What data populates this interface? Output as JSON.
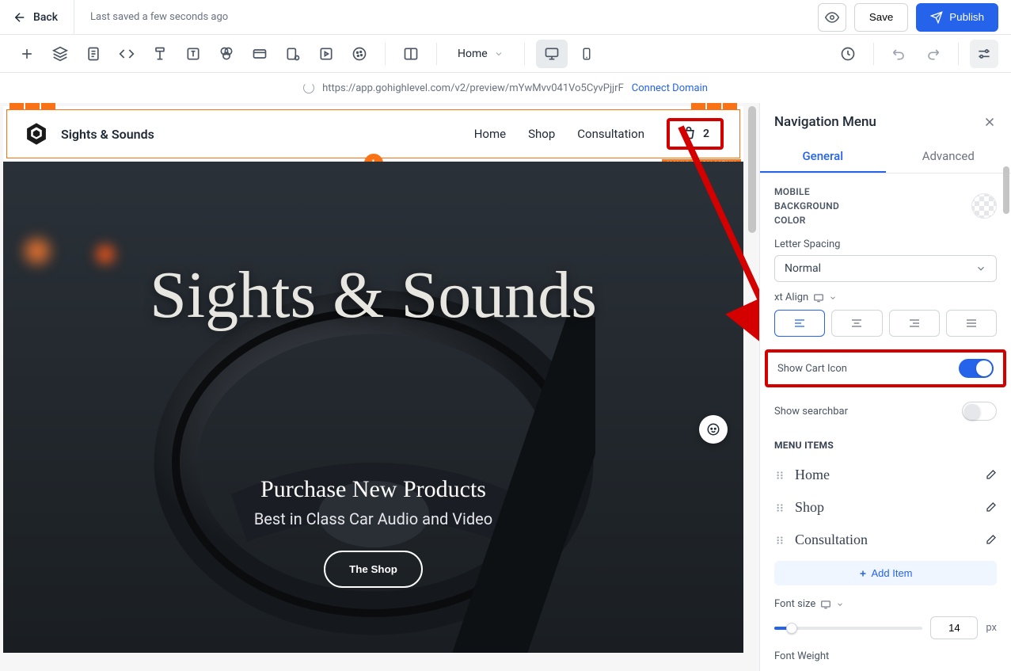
{
  "topbar": {
    "back": "Back",
    "last_saved": "Last saved a few seconds ago",
    "save": "Save",
    "publish": "Publish"
  },
  "toolbar": {
    "page_select": "Home"
  },
  "urlbar": {
    "url": "https://app.gohighlevel.com/v2/preview/mYwMvv041Vo5CyvPjjrF",
    "connect": "Connect Domain"
  },
  "site": {
    "brand": "Sights & Sounds",
    "nav": {
      "home": "Home",
      "shop": "Shop",
      "consultation": "Consultation"
    },
    "cart_count": "2",
    "nav_tag": "NAVIGATION MENU",
    "hero_title": "Sights & Sounds",
    "hero_subtitle": "Purchase New Products",
    "hero_tagline": "Best in Class Car Audio and Video",
    "hero_btn": "The Shop"
  },
  "panel": {
    "title": "Navigation Menu",
    "tabs": {
      "general": "General",
      "advanced": "Advanced"
    },
    "mobile_bg": "MOBILE BACKGROUND COLOR",
    "letter_spacing_label": "Letter Spacing",
    "letter_spacing_value": "Normal",
    "text_align_label": "xt Align",
    "show_cart": "Show Cart Icon",
    "show_search": "Show searchbar",
    "menu_items_heading": "MENU ITEMS",
    "menu_items": [
      "Home",
      "Shop",
      "Consultation"
    ],
    "add_item": "Add Item",
    "font_size_label": "Font size",
    "font_size_value": "14",
    "font_size_unit": "px",
    "font_weight_label": "Font Weight"
  }
}
